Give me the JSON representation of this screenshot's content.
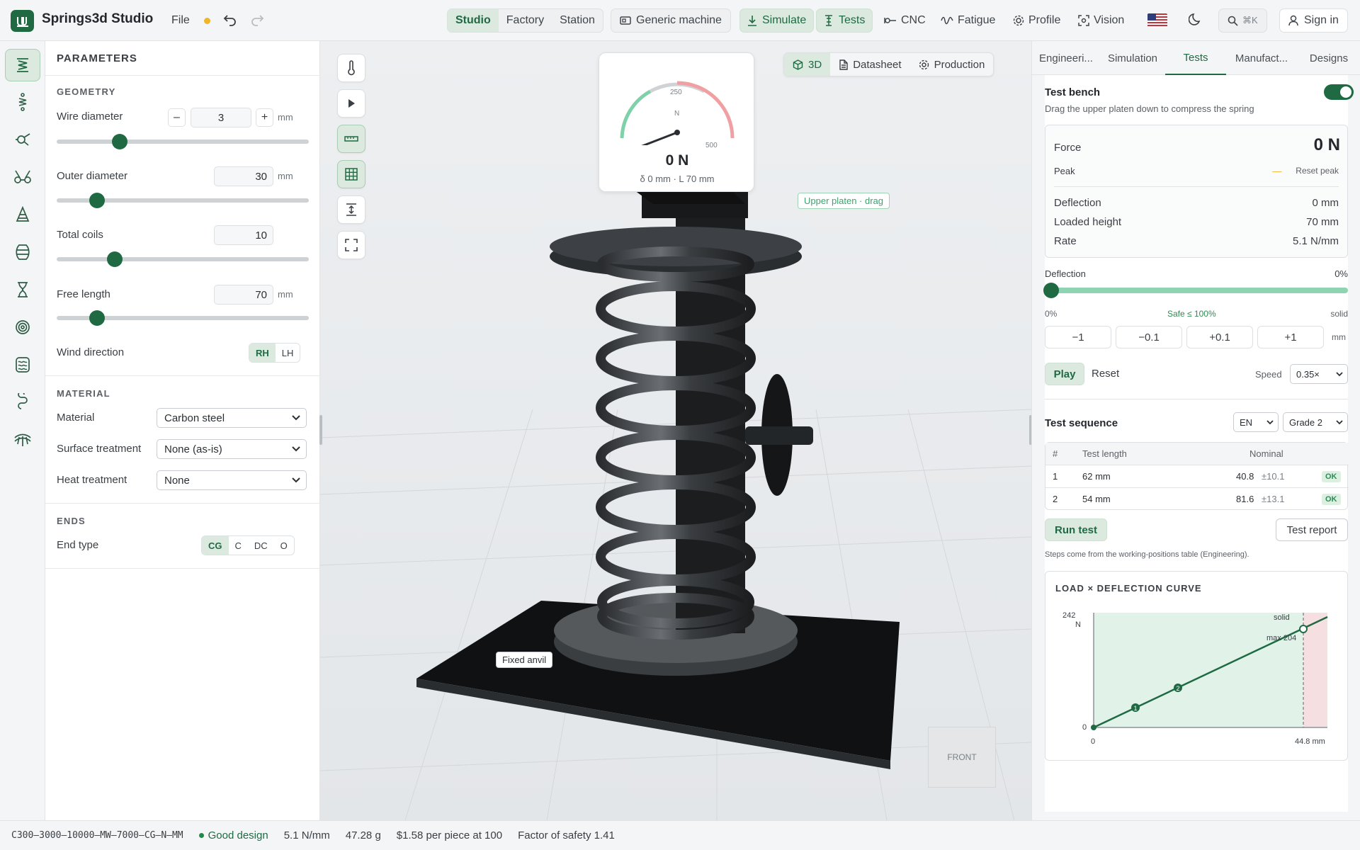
{
  "app": {
    "title": "Springs3d Studio",
    "file_menu": "File"
  },
  "topbar": {
    "modes": [
      "Studio",
      "Factory",
      "Station"
    ],
    "machine": "Generic machine",
    "actions": [
      "Simulate",
      "Tests",
      "CNC",
      "Fatigue",
      "Profile",
      "Vision"
    ],
    "search_shortcut": "⌘K",
    "sign_in": "Sign in",
    "flag": "US"
  },
  "rail": {
    "items": [
      "compression-spring",
      "extension-spring",
      "torsion-spring",
      "double-torsion-spring",
      "conical-spring",
      "barrel-spring",
      "hourglass-spring",
      "spiral-spring",
      "wave-spring",
      "wire-form",
      "disc-spring"
    ]
  },
  "params": {
    "title": "PARAMETERS",
    "geometry": {
      "heading": "GEOMETRY",
      "wire_diameter": {
        "label": "Wire diameter",
        "value": "3",
        "unit": "mm",
        "level": 0.25
      },
      "outer_diameter": {
        "label": "Outer diameter",
        "value": "30",
        "unit": "mm",
        "level": 0.16
      },
      "total_coils": {
        "label": "Total coils",
        "value": "10",
        "level": 0.23
      },
      "free_length": {
        "label": "Free length",
        "value": "70",
        "unit": "mm",
        "level": 0.16
      },
      "wind_direction": {
        "label": "Wind direction",
        "options": [
          "RH",
          "LH"
        ],
        "selected": "RH"
      }
    },
    "material": {
      "heading": "MATERIAL",
      "material": {
        "label": "Material",
        "value": "Carbon steel"
      },
      "surface": {
        "label": "Surface treatment",
        "value": "None (as-is)"
      },
      "heat": {
        "label": "Heat treatment",
        "value": "None"
      }
    },
    "ends": {
      "heading": "ENDS",
      "label": "End type",
      "options": [
        "CG",
        "C",
        "DC",
        "O"
      ],
      "selected": "CG"
    }
  },
  "viewport": {
    "view_tabs": [
      "3D",
      "Datasheet",
      "Production"
    ],
    "gauge": {
      "value": "0 N",
      "sub": "δ 0 mm · L 70 mm",
      "ticks": [
        "250",
        "N",
        "500"
      ]
    },
    "tag_upper": "Upper platen · drag",
    "tag_anvil": "Fixed anvil",
    "navcube": "FRONT"
  },
  "right": {
    "tabs": [
      "Engineeri...",
      "Simulation",
      "Tests",
      "Manufact...",
      "Designs"
    ],
    "active_tab": "Tests",
    "bench": {
      "title": "Test bench",
      "hint": "Drag the upper platen down to compress the spring",
      "enabled": true,
      "force_label": "Force",
      "force_value": "0 N",
      "peak_label": "Peak",
      "peak_value": "—",
      "reset_peak": "Reset peak",
      "deflection_label": "Deflection",
      "deflection_value": "0 mm",
      "loaded_label": "Loaded height",
      "loaded_value": "70 mm",
      "rate_label": "Rate",
      "rate_value": "5.1 N/mm"
    },
    "deflection_slider": {
      "label": "Deflection",
      "value": "0%",
      "min_label": "0%",
      "safe_label": "Safe ≤ 100%",
      "max_label": "solid",
      "level": 0
    },
    "steps": [
      "−1",
      "−0.1",
      "+0.1",
      "+1"
    ],
    "step_unit": "mm",
    "play": "Play",
    "reset": "Reset",
    "speed_label": "Speed",
    "speed": "0.35×",
    "sequence": {
      "title": "Test sequence",
      "lang": "EN",
      "grade": "Grade 2",
      "headers": [
        "#",
        "Test length",
        "Nominal"
      ],
      "rows": [
        {
          "n": "1",
          "len": "62 mm",
          "nom": "40.8",
          "tol": "±10.1",
          "status": "OK"
        },
        {
          "n": "2",
          "len": "54 mm",
          "nom": "81.6",
          "tol": "±13.1",
          "status": "OK"
        }
      ],
      "run": "Run test",
      "report": "Test report",
      "note": "Steps come from the working-positions table (Engineering)."
    },
    "curve": {
      "title": "LOAD × DEFLECTION CURVE",
      "y_top": "242",
      "y_unit": "N",
      "y_zero": "0",
      "x_zero": "0",
      "x_max": "44.8 mm",
      "solid_label": "solid",
      "max_label": "max 204"
    }
  },
  "status": {
    "code": "C300–3000–10000–MW–7000–CG–N–MM",
    "design": "Good design",
    "rate": "5.1 N/mm",
    "mass": "47.28 g",
    "price": "$1.58 per piece at 100",
    "fos": "Factor of safety 1.41"
  }
}
